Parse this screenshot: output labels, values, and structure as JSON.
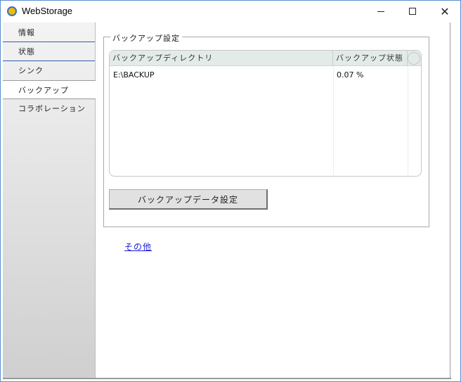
{
  "window": {
    "title": "WebStorage",
    "minimize_glyph": "",
    "maximize_glyph": "",
    "close_glyph": "✕"
  },
  "sidebar": {
    "items": [
      {
        "label": "情報"
      },
      {
        "label": "状態"
      },
      {
        "label": "シンク"
      },
      {
        "label": "バックアップ",
        "selected": true
      },
      {
        "label": "コラボレーション"
      }
    ]
  },
  "backup_settings": {
    "group_label": "バックアップ設定",
    "table": {
      "columns": [
        "バックアップディレクトリ",
        "バックアップ状態"
      ],
      "rows": [
        {
          "directory": "E:\\BACKUP",
          "status": "0.07 %"
        }
      ]
    },
    "data_settings_button": "バックアップデータ設定"
  },
  "other_link": "その他",
  "colors": {
    "accent": "#2f5fa8",
    "link": "#1a1ad6",
    "table_header": "#e3ebe8"
  }
}
